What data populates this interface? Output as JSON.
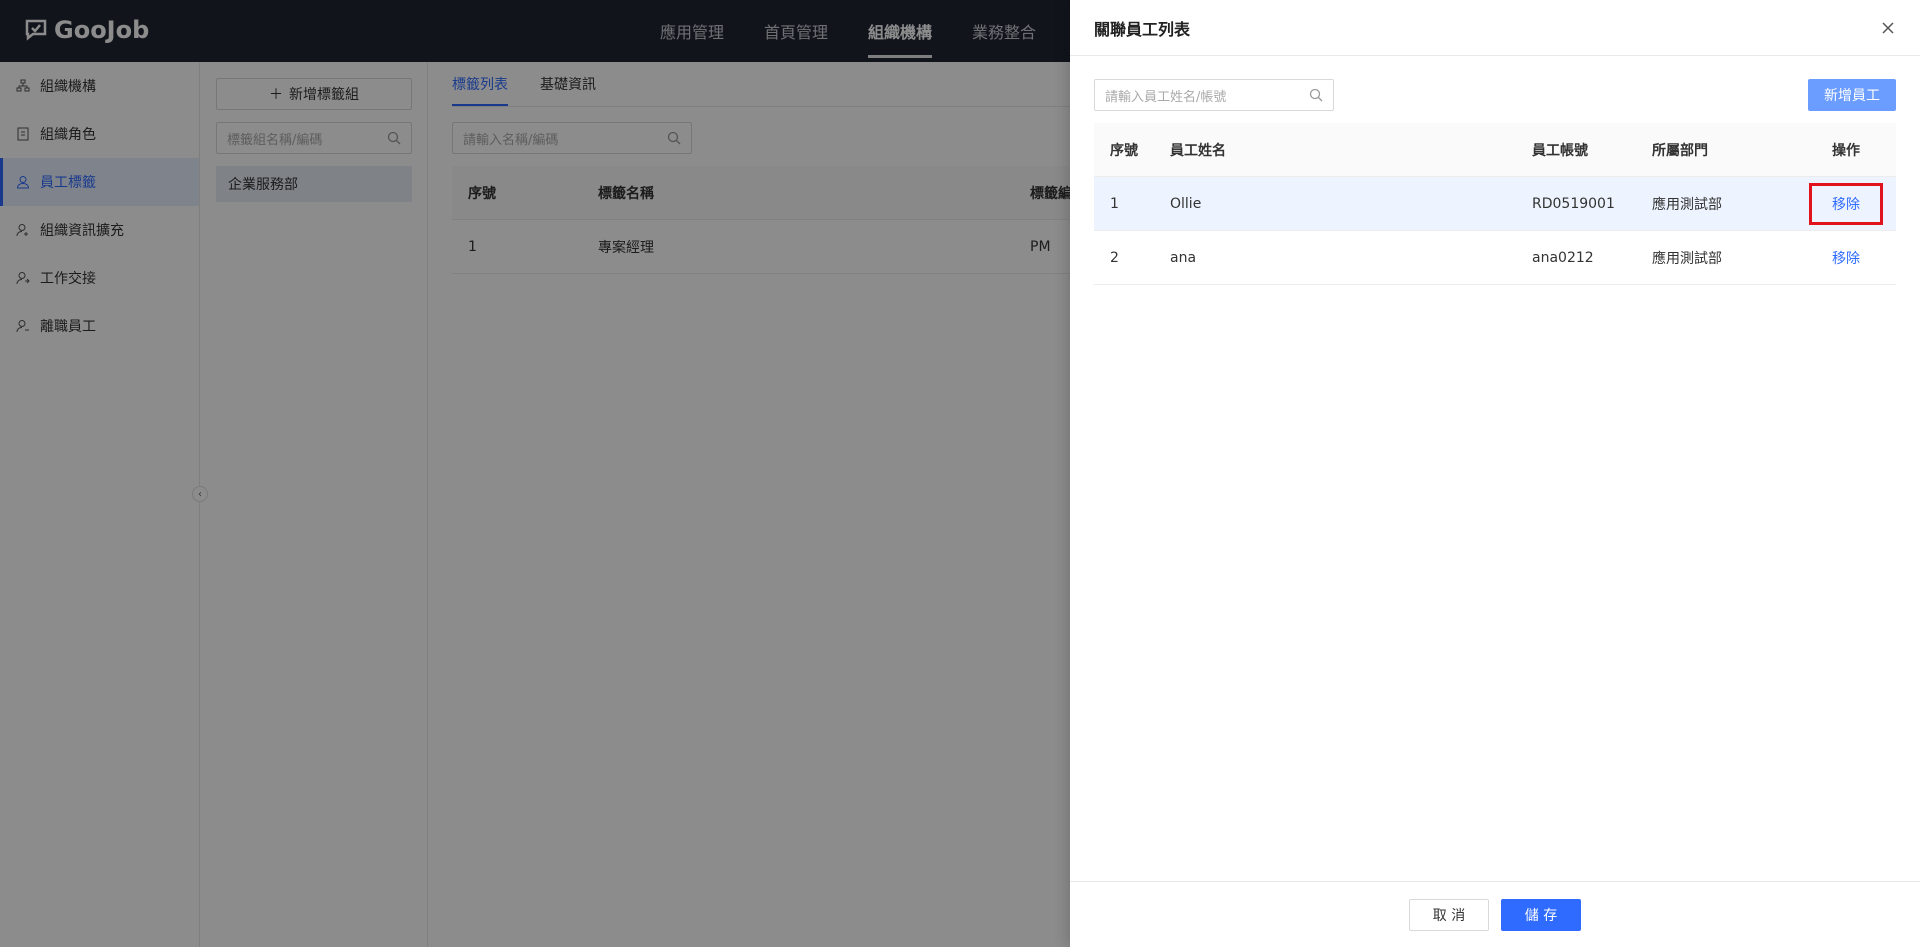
{
  "brand": {
    "name": "GooJob"
  },
  "topnav": {
    "items": [
      {
        "label": "應用管理",
        "active": false
      },
      {
        "label": "首頁管理",
        "active": false
      },
      {
        "label": "組織機構",
        "active": true
      },
      {
        "label": "業務整合",
        "active": false
      }
    ]
  },
  "sidebar": {
    "items": [
      {
        "label": "組織機構",
        "icon": "org-tree-icon"
      },
      {
        "label": "組織角色",
        "icon": "role-icon"
      },
      {
        "label": "員工標籤",
        "icon": "user-tag-icon",
        "active": true
      },
      {
        "label": "組織資訊擴充",
        "icon": "user-extend-icon"
      },
      {
        "label": "工作交接",
        "icon": "handover-icon"
      },
      {
        "label": "離職員工",
        "icon": "resigned-user-icon"
      }
    ]
  },
  "groups": {
    "add_label": "新增標籤組",
    "search_placeholder": "標籤組名稱/編碼",
    "items": [
      {
        "label": "企業服務部"
      }
    ]
  },
  "main": {
    "tabs": [
      {
        "label": "標籤列表",
        "active": true
      },
      {
        "label": "基礎資訊",
        "active": false
      }
    ],
    "search_placeholder": "請輸入名稱/編碼",
    "table": {
      "headers": [
        "序號",
        "標籤名稱",
        "標籤編"
      ],
      "rows": [
        [
          "1",
          "專案經理",
          "PM"
        ]
      ]
    }
  },
  "drawer": {
    "title": "關聯員工列表",
    "search_placeholder": "請輸入員工姓名/帳號",
    "add_button": "新增員工",
    "headers": [
      "序號",
      "員工姓名",
      "員工帳號",
      "所屬部門",
      "操作"
    ],
    "rows": [
      {
        "no": "1",
        "name": "Ollie",
        "account": "RD0519001",
        "dept": "應用測試部",
        "action": "移除"
      },
      {
        "no": "2",
        "name": "ana",
        "account": "ana0212",
        "dept": "應用測試部",
        "action": "移除"
      }
    ],
    "cancel_label": "取 消",
    "save_label": "儲 存"
  },
  "colors": {
    "accent": "#2f6bff",
    "header_bg": "#1f2532",
    "highlight": "#e1141e"
  }
}
